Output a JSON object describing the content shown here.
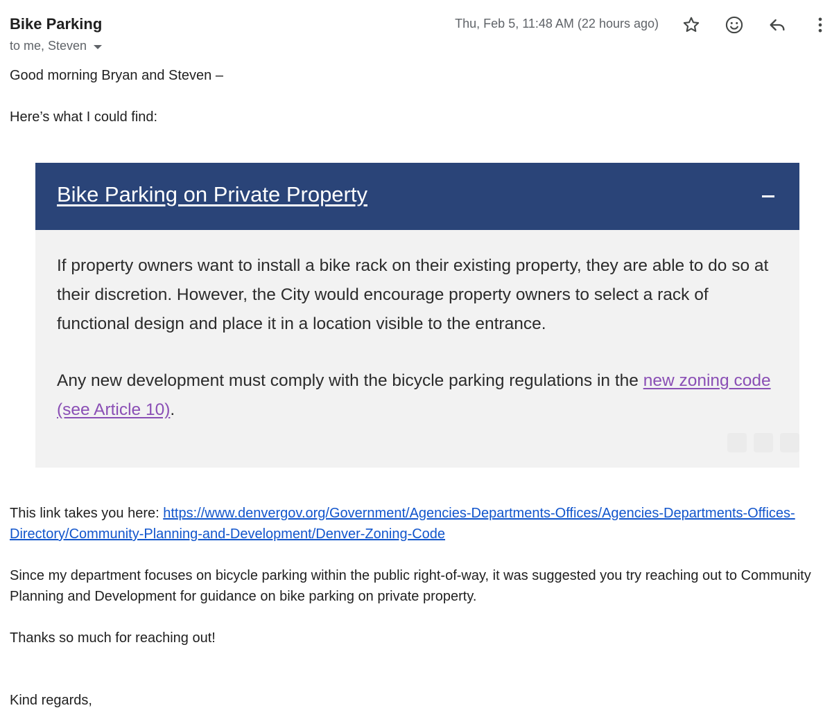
{
  "email": {
    "subject": "Bike Parking",
    "recipients": "to me, Steven",
    "timestamp": "Thu, Feb 5, 11:48 AM (22 hours ago)",
    "actions": {
      "star_icon": "star-icon",
      "emoji_icon": "emoji-icon",
      "reply_icon": "reply-icon",
      "more_icon": "more-vert-icon"
    },
    "greeting": "Good morning Bryan and Steven –",
    "intro": "Here’s what I could find:",
    "embed": {
      "title": "Bike Parking on Private Property",
      "collapse_icon": "minus-icon",
      "para1": "If property owners want to install a bike rack on their existing property, they are able to do so at their discretion. However, the City would encourage property owners to select a rack of functional design and place it in a location visible to the entrance.",
      "para2_before": "Any new development must comply with the bicycle parking regulations in the ",
      "para2_link": "new zoning code (see Article 10)",
      "para2_after": ".",
      "colors": {
        "header": "#2a4478",
        "background": "#f2f2f2",
        "link": "#8a4fb5"
      }
    },
    "link_prefix": "This link takes you here: ",
    "link_url": "https://www.denvergov.org/Government/Agencies-Departments-Offices/Agencies-Departments-Offices-Directory/Community-Planning-and-Development/Denver-Zoning-Code",
    "para_department": "Since my department focuses on bicycle parking within the public right-of-way, it was suggested you try reaching out to Community Planning and Development for guidance on bike parking on private property.",
    "thanks": "Thanks so much for reaching out!",
    "signoff": "Kind regards,",
    "link_color": "#1155cc"
  }
}
